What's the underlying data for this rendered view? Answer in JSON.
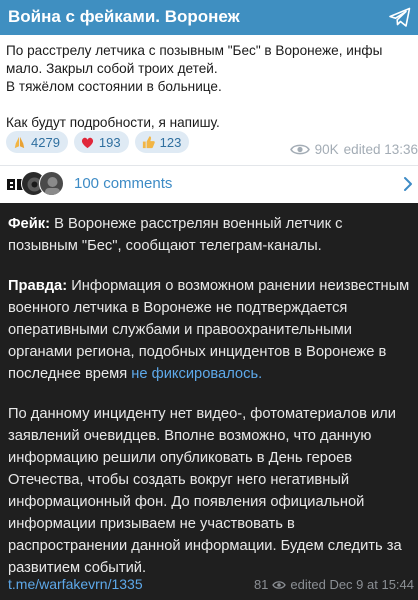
{
  "screenshot": {
    "channel_title": "Война с фейками. Воронеж",
    "post_lines": [
      "По расстрелу летчика с позывным \"Бес\" в Воронеже,  инфы",
      "мало. Закрыл собой троих детей.",
      "В тяжёлом состоянии в больнице.",
      "",
      "Как будут подробности, я напишу."
    ],
    "reactions": [
      {
        "emoji": "pray",
        "count": "4279"
      },
      {
        "emoji": "heart",
        "count": "193"
      },
      {
        "emoji": "thumbs-up",
        "count": "123"
      }
    ],
    "views": "90K",
    "edited": "edited 13:36",
    "comments": "100 comments"
  },
  "post": {
    "fake_label": "Фейк:",
    "fake_text": " В Воронеже расстрелян военный летчик с позывным \"Бес\", сообщают телеграм-каналы.",
    "truth_label": "Правда:",
    "truth_text": " Информация о возможном ранении неизвестным военного летчика в Воронеже не подтверждается оперативными службами и правоохранительными органами региона, подобных инцидентов в Воронеже в последнее время ",
    "truth_link": "не фиксировалось.",
    "closing": "По данному инциденту нет видео-, фотоматериалов или заявлений очевидцев. Вполне возможно, что данную информацию решили опубликовать в День героев Отечества, чтобы создать вокруг него негативный информационный фон. До появления официальной информации призываем не участвовать в распространении данной информации. Будем следить за развитием событий."
  },
  "footer": {
    "link": "t.me/warfakevrn/1335",
    "views": "81",
    "edited": "edited  Dec 9 at 15:44"
  },
  "colors": {
    "header": "#3f8fc1",
    "link": "#5ea9ea",
    "dark_bg": "#1f1f1f"
  }
}
